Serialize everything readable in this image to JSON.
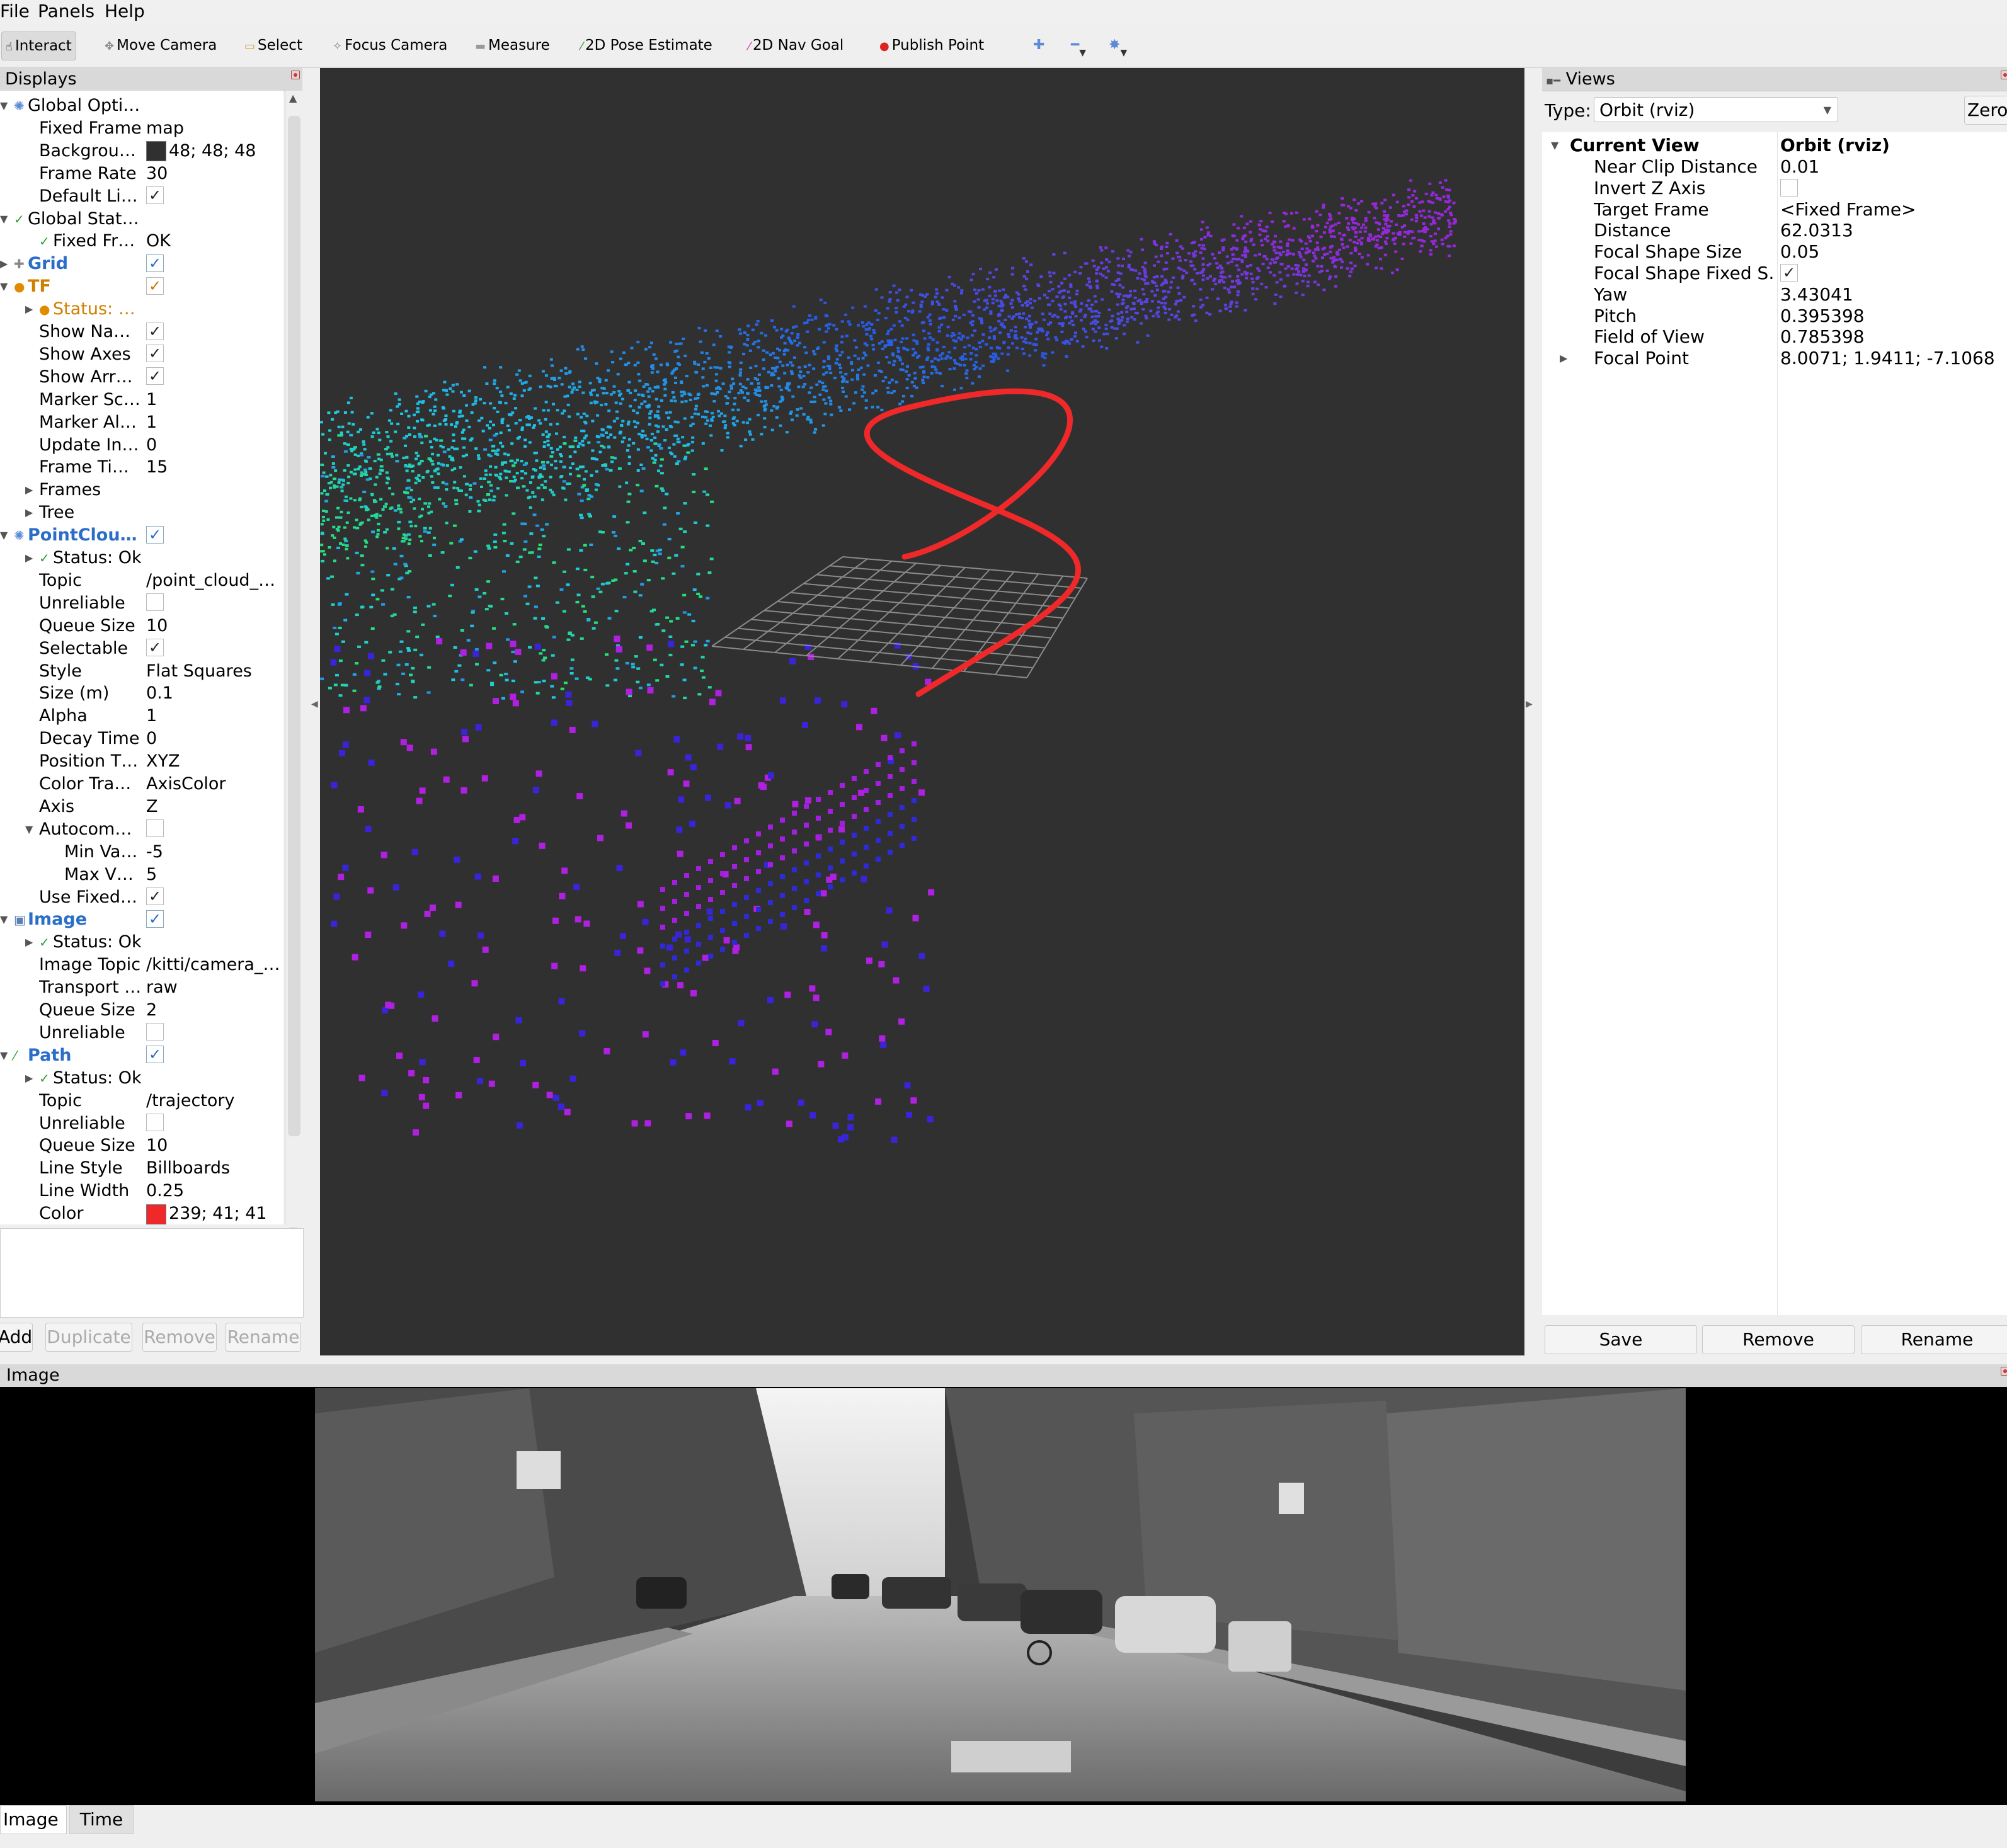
{
  "menu": [
    "File",
    "Panels",
    "Help"
  ],
  "toolbar": {
    "interact": "Interact",
    "move_camera": "Move Camera",
    "select": "Select",
    "focus_camera": "Focus Camera",
    "measure": "Measure",
    "pose_estimate": "2D Pose Estimate",
    "nav_goal": "2D Nav Goal",
    "publish_point": "Publish Point"
  },
  "displays": {
    "title": "Displays",
    "rows": [
      {
        "key": "Global Opti…",
        "val": ""
      },
      {
        "key": "Fixed Frame",
        "val": "map"
      },
      {
        "key": "Backgrou…",
        "val": "48; 48; 48"
      },
      {
        "key": "Frame Rate",
        "val": "30"
      },
      {
        "key": "Default Li…",
        "val": ""
      },
      {
        "key": "Global Stat…",
        "val": ""
      },
      {
        "key": "Fixed Fr…",
        "val": "OK"
      },
      {
        "key": "Grid",
        "val": ""
      },
      {
        "key": "TF",
        "val": ""
      },
      {
        "key": "Status: …",
        "val": ""
      },
      {
        "key": "Show Na…",
        "val": ""
      },
      {
        "key": "Show Axes",
        "val": ""
      },
      {
        "key": "Show Arr…",
        "val": ""
      },
      {
        "key": "Marker Sc…",
        "val": "1"
      },
      {
        "key": "Marker Al…",
        "val": "1"
      },
      {
        "key": "Update In…",
        "val": "0"
      },
      {
        "key": "Frame Ti…",
        "val": "15"
      },
      {
        "key": "Frames",
        "val": ""
      },
      {
        "key": "Tree",
        "val": ""
      },
      {
        "key": "PointCloud2",
        "val": ""
      },
      {
        "key": "Status: Ok",
        "val": ""
      },
      {
        "key": "Topic",
        "val": "/point_cloud_…"
      },
      {
        "key": "Unreliable",
        "val": ""
      },
      {
        "key": "Queue Size",
        "val": "10"
      },
      {
        "key": "Selectable",
        "val": ""
      },
      {
        "key": "Style",
        "val": "Flat Squares"
      },
      {
        "key": "Size (m)",
        "val": "0.1"
      },
      {
        "key": "Alpha",
        "val": "1"
      },
      {
        "key": "Decay Time",
        "val": "0"
      },
      {
        "key": "Position T…",
        "val": "XYZ"
      },
      {
        "key": "Color Tra…",
        "val": "AxisColor"
      },
      {
        "key": "Axis",
        "val": "Z"
      },
      {
        "key": "Autocom…",
        "val": ""
      },
      {
        "key": "Min Va…",
        "val": "-5"
      },
      {
        "key": "Max V…",
        "val": "5"
      },
      {
        "key": "Use Fixed …",
        "val": ""
      },
      {
        "key": "Image",
        "val": ""
      },
      {
        "key": "Status: Ok",
        "val": ""
      },
      {
        "key": "Image Topic",
        "val": "/kitti/camera_…"
      },
      {
        "key": "Transport …",
        "val": "raw"
      },
      {
        "key": "Queue Size",
        "val": "2"
      },
      {
        "key": "Unreliable",
        "val": ""
      },
      {
        "key": "Path",
        "val": ""
      },
      {
        "key": "Status: Ok",
        "val": ""
      },
      {
        "key": "Topic",
        "val": "/trajectory"
      },
      {
        "key": "Unreliable",
        "val": ""
      },
      {
        "key": "Queue Size",
        "val": "10"
      },
      {
        "key": "Line Style",
        "val": "Billboards"
      },
      {
        "key": "Line Width",
        "val": "0.25"
      },
      {
        "key": "Color",
        "val": "239; 41; 41"
      }
    ],
    "buttons": {
      "add": "Add",
      "duplicate": "Duplicate",
      "remove": "Remove",
      "rename": "Rename"
    }
  },
  "colors": {
    "background_swatch": "#303030",
    "path_color": "#ef2929"
  },
  "views": {
    "title": "Views",
    "type_label": "Type:",
    "type_value": "Orbit (rviz)",
    "zero_label": "Zero",
    "current_view": "Current View",
    "current_view_type": "Orbit (rviz)",
    "props": [
      {
        "key": "Near Clip Distance",
        "val": "0.01"
      },
      {
        "key": "Invert Z Axis",
        "val": ""
      },
      {
        "key": "Target Frame",
        "val": "<Fixed Frame>"
      },
      {
        "key": "Distance",
        "val": "62.0313"
      },
      {
        "key": "Focal Shape Size",
        "val": "0.05"
      },
      {
        "key": "Focal Shape Fixed S…",
        "val": ""
      },
      {
        "key": "Yaw",
        "val": "3.43041"
      },
      {
        "key": "Pitch",
        "val": "0.395398"
      },
      {
        "key": "Field of View",
        "val": "0.785398"
      },
      {
        "key": "Focal Point",
        "val": "8.0071; 1.9411; -7.1068"
      }
    ],
    "buttons": {
      "save": "Save",
      "remove": "Remove",
      "rename": "Rename"
    }
  },
  "image_panel": {
    "title": "Image"
  },
  "bottom_tabs": [
    "Image",
    "Time"
  ]
}
